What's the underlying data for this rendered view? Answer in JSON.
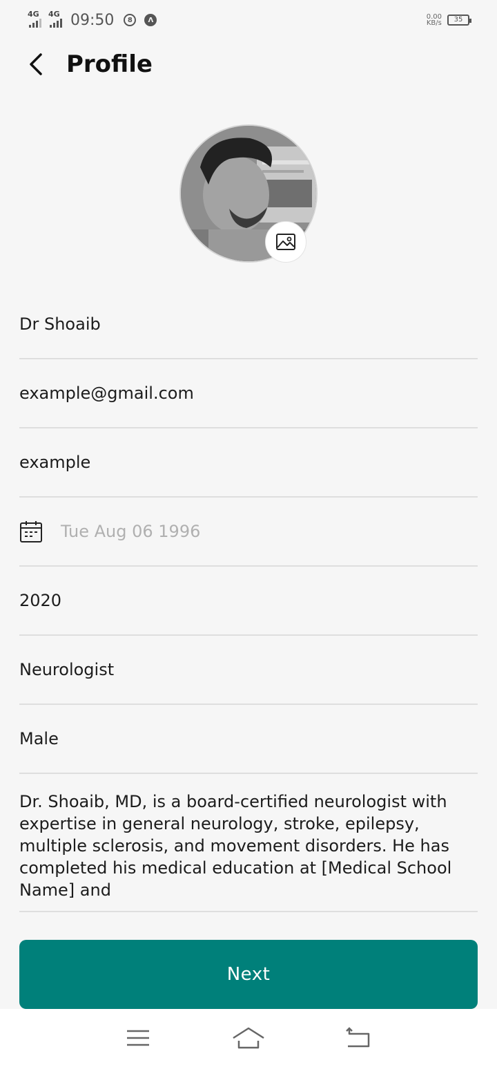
{
  "status_bar": {
    "signal_1": "4G",
    "signal_2": "4G",
    "time": "09:50",
    "net_speed_value": "0.00",
    "net_speed_unit": "KB/s",
    "battery": "35"
  },
  "header": {
    "title": "Profile",
    "back_icon": "chevron-left-icon"
  },
  "profile": {
    "avatar_icon": "avatar-photo",
    "change_photo_icon": "image-icon"
  },
  "form": {
    "name": "Dr Shoaib",
    "email": "example@gmail.com",
    "username": "example",
    "dob_placeholder": "Tue Aug 06 1996",
    "year": "2020",
    "specialization": "Neurologist",
    "gender": "Male",
    "bio": "Dr. Shoaib, MD, is a board-certified neurologist with expertise in general neurology, stroke, epilepsy, multiple sclerosis, and movement disorders. He has completed his medical education at [Medical School Name] and"
  },
  "actions": {
    "next_label": "Next"
  },
  "nav": {
    "menu_icon": "menu-icon",
    "home_icon": "home-icon",
    "back_icon": "back-icon"
  },
  "colors": {
    "accent": "#00807a",
    "background": "#f6f6f6",
    "divider": "#dedede",
    "placeholder": "#b0b0b0"
  }
}
